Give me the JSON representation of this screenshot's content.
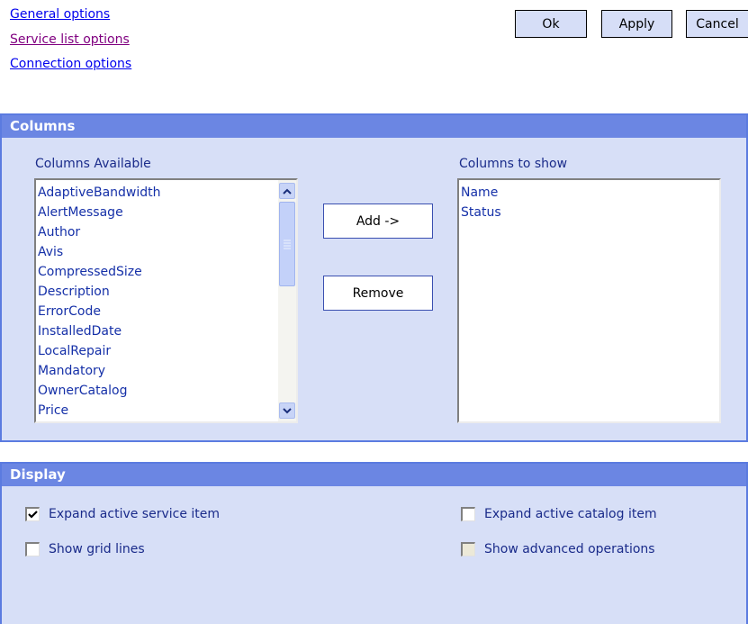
{
  "nav": {
    "links": [
      {
        "label": "General options",
        "color": "#0000ee"
      },
      {
        "label": "Service list options",
        "color": "#800080"
      },
      {
        "label": "Connection options",
        "color": "#0000ee"
      }
    ]
  },
  "toolbar": {
    "ok_label": "Ok",
    "apply_label": "Apply",
    "cancel_label": "Cancel"
  },
  "columns_panel": {
    "title": "Columns",
    "available_label": "Columns Available",
    "show_label": "Columns to show",
    "available_items": [
      "AdaptiveBandwidth",
      "AlertMessage",
      "Author",
      "Avis",
      "CompressedSize",
      "Description",
      "ErrorCode",
      "InstalledDate",
      "LocalRepair",
      "Mandatory",
      "OwnerCatalog",
      "Price"
    ],
    "shown_items": [
      "Name",
      "Status"
    ],
    "add_label": "Add ->",
    "remove_label": "Remove",
    "scroll_up_icon": "arrow-up-icon",
    "scroll_down_icon": "arrow-down-icon"
  },
  "display_panel": {
    "title": "Display",
    "options": [
      {
        "label": "Expand active service item",
        "checked": true,
        "enabled": true
      },
      {
        "label": "Expand active catalog item",
        "checked": false,
        "enabled": true
      },
      {
        "label": "Show grid lines",
        "checked": false,
        "enabled": true
      },
      {
        "label": "Show advanced operations",
        "checked": false,
        "enabled": false
      }
    ]
  },
  "colors": {
    "panel_header": "#6b86e3",
    "panel_body": "#d7dff7",
    "panel_border": "#5b7be0",
    "button_face": "#d6def7",
    "list_text": "#1530a8"
  }
}
